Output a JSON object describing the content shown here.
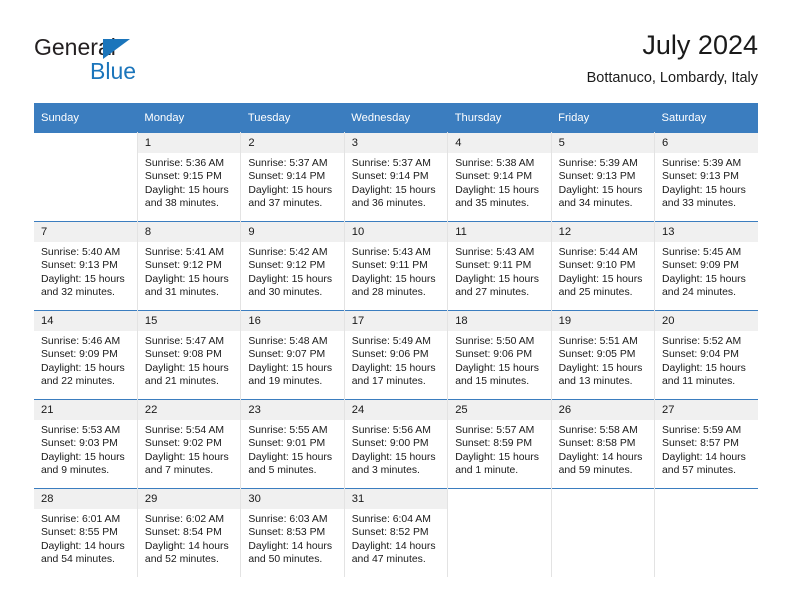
{
  "brand": {
    "word1": "General",
    "word2": "Blue",
    "triangle_color": "#1b75bb"
  },
  "header": {
    "title": "July 2024",
    "location": "Bottanuco, Lombardy, Italy"
  },
  "theme": {
    "header_bg": "#3b7dbf",
    "header_text": "#ffffff",
    "daynum_bg": "#f0f0f0",
    "cell_border": "#e3e3e3"
  },
  "weekdays": [
    "Sunday",
    "Monday",
    "Tuesday",
    "Wednesday",
    "Thursday",
    "Friday",
    "Saturday"
  ],
  "weeks": [
    [
      {
        "day": "",
        "empty": true
      },
      {
        "day": "1",
        "sunrise": "Sunrise: 5:36 AM",
        "sunset": "Sunset: 9:15 PM",
        "daylight1": "Daylight: 15 hours",
        "daylight2": "and 38 minutes."
      },
      {
        "day": "2",
        "sunrise": "Sunrise: 5:37 AM",
        "sunset": "Sunset: 9:14 PM",
        "daylight1": "Daylight: 15 hours",
        "daylight2": "and 37 minutes."
      },
      {
        "day": "3",
        "sunrise": "Sunrise: 5:37 AM",
        "sunset": "Sunset: 9:14 PM",
        "daylight1": "Daylight: 15 hours",
        "daylight2": "and 36 minutes."
      },
      {
        "day": "4",
        "sunrise": "Sunrise: 5:38 AM",
        "sunset": "Sunset: 9:14 PM",
        "daylight1": "Daylight: 15 hours",
        "daylight2": "and 35 minutes."
      },
      {
        "day": "5",
        "sunrise": "Sunrise: 5:39 AM",
        "sunset": "Sunset: 9:13 PM",
        "daylight1": "Daylight: 15 hours",
        "daylight2": "and 34 minutes."
      },
      {
        "day": "6",
        "sunrise": "Sunrise: 5:39 AM",
        "sunset": "Sunset: 9:13 PM",
        "daylight1": "Daylight: 15 hours",
        "daylight2": "and 33 minutes."
      }
    ],
    [
      {
        "day": "7",
        "sunrise": "Sunrise: 5:40 AM",
        "sunset": "Sunset: 9:13 PM",
        "daylight1": "Daylight: 15 hours",
        "daylight2": "and 32 minutes."
      },
      {
        "day": "8",
        "sunrise": "Sunrise: 5:41 AM",
        "sunset": "Sunset: 9:12 PM",
        "daylight1": "Daylight: 15 hours",
        "daylight2": "and 31 minutes."
      },
      {
        "day": "9",
        "sunrise": "Sunrise: 5:42 AM",
        "sunset": "Sunset: 9:12 PM",
        "daylight1": "Daylight: 15 hours",
        "daylight2": "and 30 minutes."
      },
      {
        "day": "10",
        "sunrise": "Sunrise: 5:43 AM",
        "sunset": "Sunset: 9:11 PM",
        "daylight1": "Daylight: 15 hours",
        "daylight2": "and 28 minutes."
      },
      {
        "day": "11",
        "sunrise": "Sunrise: 5:43 AM",
        "sunset": "Sunset: 9:11 PM",
        "daylight1": "Daylight: 15 hours",
        "daylight2": "and 27 minutes."
      },
      {
        "day": "12",
        "sunrise": "Sunrise: 5:44 AM",
        "sunset": "Sunset: 9:10 PM",
        "daylight1": "Daylight: 15 hours",
        "daylight2": "and 25 minutes."
      },
      {
        "day": "13",
        "sunrise": "Sunrise: 5:45 AM",
        "sunset": "Sunset: 9:09 PM",
        "daylight1": "Daylight: 15 hours",
        "daylight2": "and 24 minutes."
      }
    ],
    [
      {
        "day": "14",
        "sunrise": "Sunrise: 5:46 AM",
        "sunset": "Sunset: 9:09 PM",
        "daylight1": "Daylight: 15 hours",
        "daylight2": "and 22 minutes."
      },
      {
        "day": "15",
        "sunrise": "Sunrise: 5:47 AM",
        "sunset": "Sunset: 9:08 PM",
        "daylight1": "Daylight: 15 hours",
        "daylight2": "and 21 minutes."
      },
      {
        "day": "16",
        "sunrise": "Sunrise: 5:48 AM",
        "sunset": "Sunset: 9:07 PM",
        "daylight1": "Daylight: 15 hours",
        "daylight2": "and 19 minutes."
      },
      {
        "day": "17",
        "sunrise": "Sunrise: 5:49 AM",
        "sunset": "Sunset: 9:06 PM",
        "daylight1": "Daylight: 15 hours",
        "daylight2": "and 17 minutes."
      },
      {
        "day": "18",
        "sunrise": "Sunrise: 5:50 AM",
        "sunset": "Sunset: 9:06 PM",
        "daylight1": "Daylight: 15 hours",
        "daylight2": "and 15 minutes."
      },
      {
        "day": "19",
        "sunrise": "Sunrise: 5:51 AM",
        "sunset": "Sunset: 9:05 PM",
        "daylight1": "Daylight: 15 hours",
        "daylight2": "and 13 minutes."
      },
      {
        "day": "20",
        "sunrise": "Sunrise: 5:52 AM",
        "sunset": "Sunset: 9:04 PM",
        "daylight1": "Daylight: 15 hours",
        "daylight2": "and 11 minutes."
      }
    ],
    [
      {
        "day": "21",
        "sunrise": "Sunrise: 5:53 AM",
        "sunset": "Sunset: 9:03 PM",
        "daylight1": "Daylight: 15 hours",
        "daylight2": "and 9 minutes."
      },
      {
        "day": "22",
        "sunrise": "Sunrise: 5:54 AM",
        "sunset": "Sunset: 9:02 PM",
        "daylight1": "Daylight: 15 hours",
        "daylight2": "and 7 minutes."
      },
      {
        "day": "23",
        "sunrise": "Sunrise: 5:55 AM",
        "sunset": "Sunset: 9:01 PM",
        "daylight1": "Daylight: 15 hours",
        "daylight2": "and 5 minutes."
      },
      {
        "day": "24",
        "sunrise": "Sunrise: 5:56 AM",
        "sunset": "Sunset: 9:00 PM",
        "daylight1": "Daylight: 15 hours",
        "daylight2": "and 3 minutes."
      },
      {
        "day": "25",
        "sunrise": "Sunrise: 5:57 AM",
        "sunset": "Sunset: 8:59 PM",
        "daylight1": "Daylight: 15 hours",
        "daylight2": "and 1 minute."
      },
      {
        "day": "26",
        "sunrise": "Sunrise: 5:58 AM",
        "sunset": "Sunset: 8:58 PM",
        "daylight1": "Daylight: 14 hours",
        "daylight2": "and 59 minutes."
      },
      {
        "day": "27",
        "sunrise": "Sunrise: 5:59 AM",
        "sunset": "Sunset: 8:57 PM",
        "daylight1": "Daylight: 14 hours",
        "daylight2": "and 57 minutes."
      }
    ],
    [
      {
        "day": "28",
        "sunrise": "Sunrise: 6:01 AM",
        "sunset": "Sunset: 8:55 PM",
        "daylight1": "Daylight: 14 hours",
        "daylight2": "and 54 minutes."
      },
      {
        "day": "29",
        "sunrise": "Sunrise: 6:02 AM",
        "sunset": "Sunset: 8:54 PM",
        "daylight1": "Daylight: 14 hours",
        "daylight2": "and 52 minutes."
      },
      {
        "day": "30",
        "sunrise": "Sunrise: 6:03 AM",
        "sunset": "Sunset: 8:53 PM",
        "daylight1": "Daylight: 14 hours",
        "daylight2": "and 50 minutes."
      },
      {
        "day": "31",
        "sunrise": "Sunrise: 6:04 AM",
        "sunset": "Sunset: 8:52 PM",
        "daylight1": "Daylight: 14 hours",
        "daylight2": "and 47 minutes."
      },
      {
        "day": "",
        "empty": true
      },
      {
        "day": "",
        "empty": true
      },
      {
        "day": "",
        "empty": true
      }
    ]
  ]
}
